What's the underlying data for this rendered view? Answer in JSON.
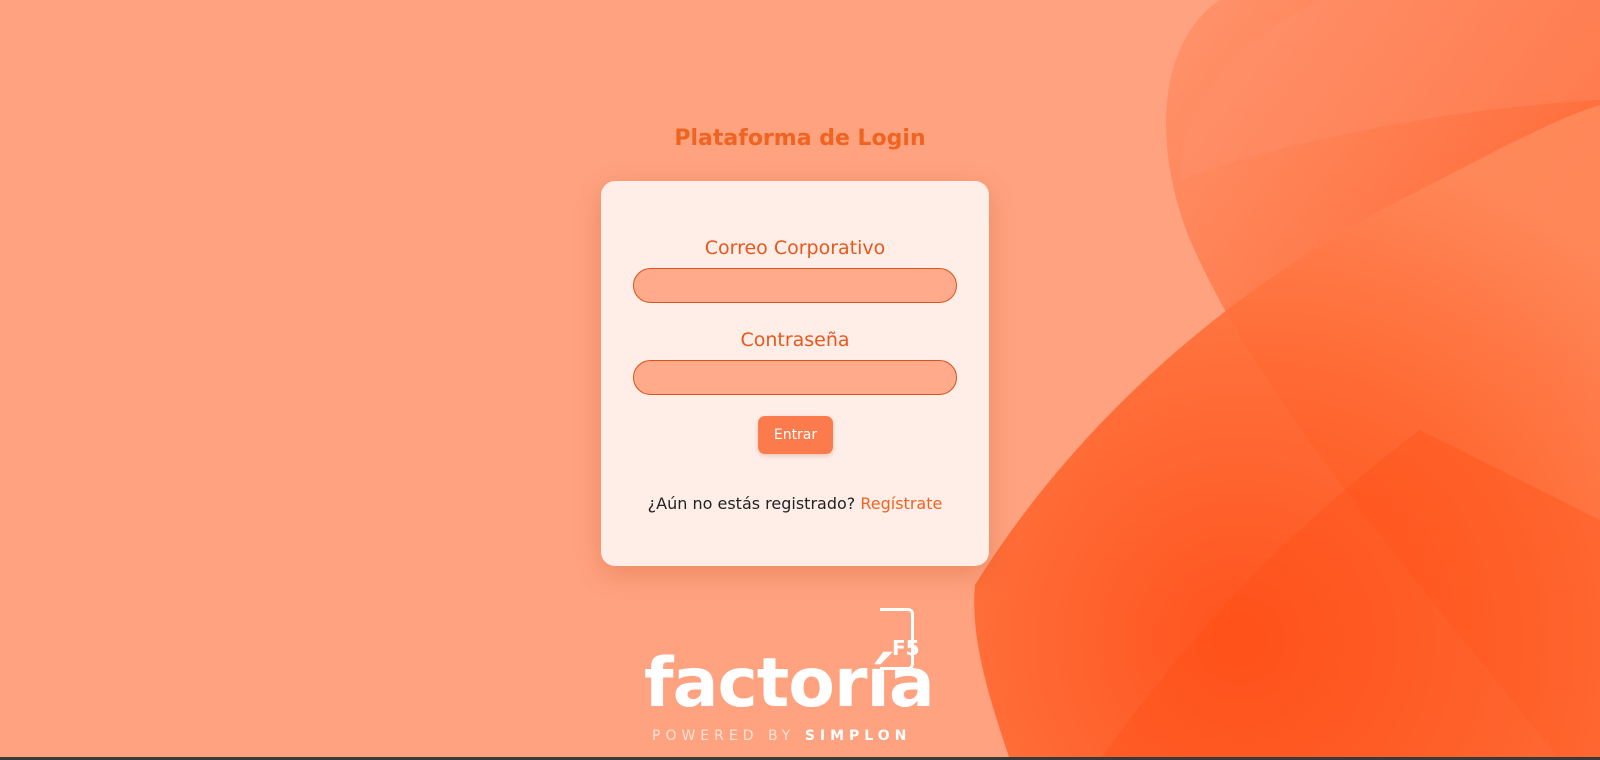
{
  "header": {
    "title": "Plataforma de Login"
  },
  "login_form": {
    "email_label": "Correo Corporativo",
    "email_value": "",
    "password_label": "Contraseña",
    "password_value": "",
    "submit_label": "Entrar",
    "register_prompt": "¿Aún no estás registrado?",
    "register_link": "Regístrate"
  },
  "logo": {
    "badge": "F5",
    "name": "factoría",
    "tagline_prefix": "POWERED BY",
    "tagline_brand": "SIMPLON"
  },
  "colors": {
    "background": "#ffa27f",
    "accent": "#ee6420",
    "card": "#fff0ea",
    "input_fill": "#ffab8b",
    "button": "#fb7b4c"
  }
}
